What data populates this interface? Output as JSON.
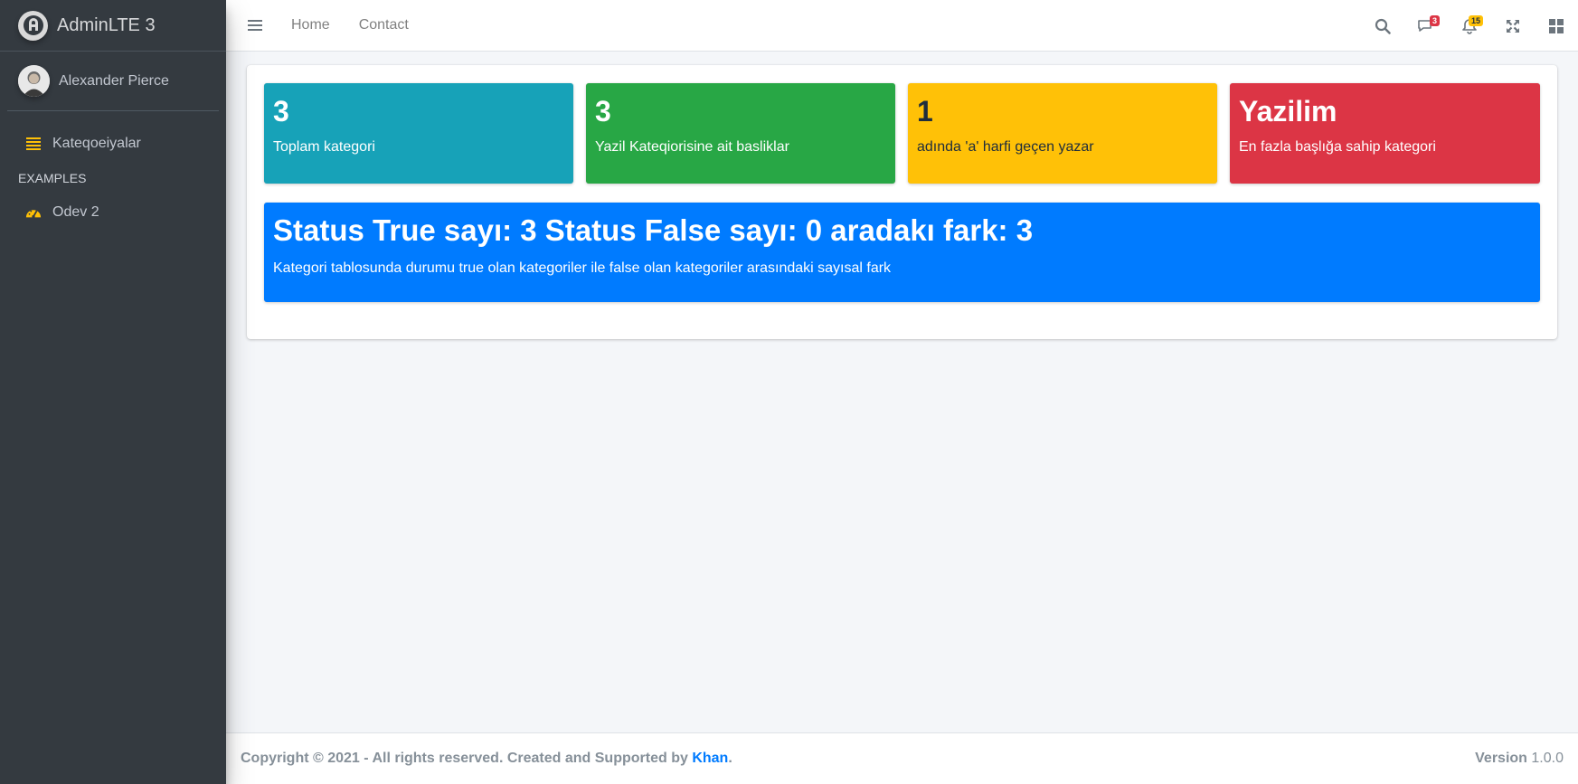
{
  "brand": {
    "title": "AdminLTE 3"
  },
  "user": {
    "name": "Alexander Pierce"
  },
  "sidebar": {
    "items": [
      {
        "label": "Kateqoeiyalar",
        "icon": "list-icon"
      }
    ],
    "header": "EXAMPLES",
    "examples": [
      {
        "label": "Odev 2",
        "icon": "tachometer-icon"
      }
    ]
  },
  "topbar": {
    "links": [
      "Home",
      "Contact"
    ],
    "messages_badge": "3",
    "notifications_badge": "15"
  },
  "stats": [
    {
      "value": "3",
      "label": "Toplam kategori",
      "color": "#17a2b8"
    },
    {
      "value": "3",
      "label": "Yazil Kateqiorisine ait basliklar",
      "color": "#28a745"
    },
    {
      "value": "1",
      "label": "adında 'a' harfi geçen yazar",
      "color": "#ffc107"
    },
    {
      "value": "Yazilim",
      "label": "En fazla başlığa sahip kategori",
      "color": "#dc3545"
    }
  ],
  "status_box": {
    "title": "Status True sayı: 3 Status False sayı: 0 aradakı fark: 3",
    "label": "Kategori tablosunda durumu true olan kategoriler ile false olan kategoriler arasındaki sayısal fark",
    "color": "#007bff"
  },
  "footer": {
    "copyright": "Copyright © 2021 - All rights reserved. Created and Supported by ",
    "author": "Khan",
    "period": ".",
    "version_label": "Version",
    "version": "1.0.0"
  }
}
